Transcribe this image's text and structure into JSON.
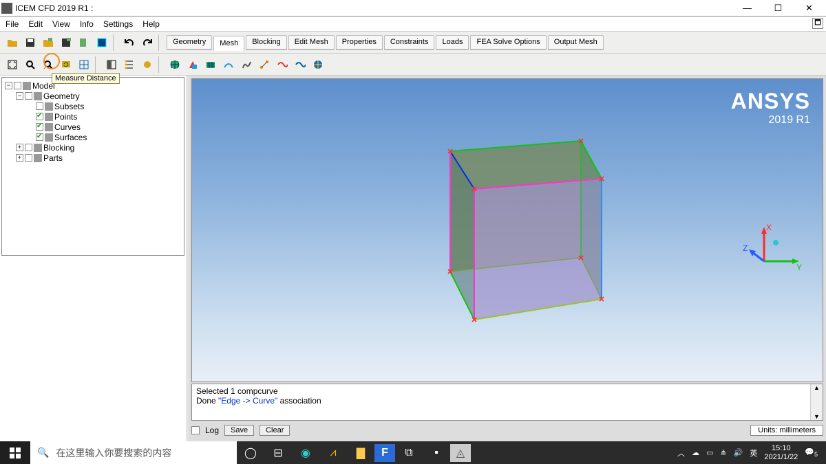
{
  "window": {
    "title": "ICEM CFD 2019 R1 :"
  },
  "menu": {
    "items": [
      "File",
      "Edit",
      "View",
      "Info",
      "Settings",
      "Help"
    ]
  },
  "tooltip": "Measure Distance",
  "tabs": [
    "Geometry",
    "Mesh",
    "Blocking",
    "Edit Mesh",
    "Properties",
    "Constraints",
    "Loads",
    "FEA Solve Options",
    "Output Mesh"
  ],
  "activeTab": "Mesh",
  "tree": [
    {
      "level": 0,
      "box": "-",
      "chk": "",
      "label": "Model"
    },
    {
      "level": 1,
      "box": "-",
      "chk": "",
      "label": "Geometry"
    },
    {
      "level": 2,
      "box": "",
      "chk": "empty",
      "label": "Subsets"
    },
    {
      "level": 2,
      "box": "",
      "chk": "green",
      "label": "Points"
    },
    {
      "level": 2,
      "box": "",
      "chk": "green",
      "label": "Curves"
    },
    {
      "level": 2,
      "box": "",
      "chk": "green",
      "label": "Surfaces"
    },
    {
      "level": 1,
      "box": "+",
      "chk": "",
      "label": "Blocking"
    },
    {
      "level": 1,
      "box": "+",
      "chk": "",
      "label": "Parts"
    }
  ],
  "viewport": {
    "brand": "ANSYS",
    "version": "2019 R1",
    "triad": {
      "x": "X",
      "y": "Y",
      "z": "Z"
    }
  },
  "messages": {
    "line1": "Selected 1 compcurve",
    "line2a": "Done ",
    "line2link": "\"Edge -> Curve\"",
    "line2b": " association"
  },
  "status": {
    "log": "Log",
    "save": "Save",
    "clear": "Clear",
    "units": "Units: millimeters"
  },
  "taskbar": {
    "searchPlaceholder": "在这里输入你要搜索的内容",
    "ime": "英",
    "time": "15:10",
    "date": "2021/1/22",
    "notif": "5"
  }
}
